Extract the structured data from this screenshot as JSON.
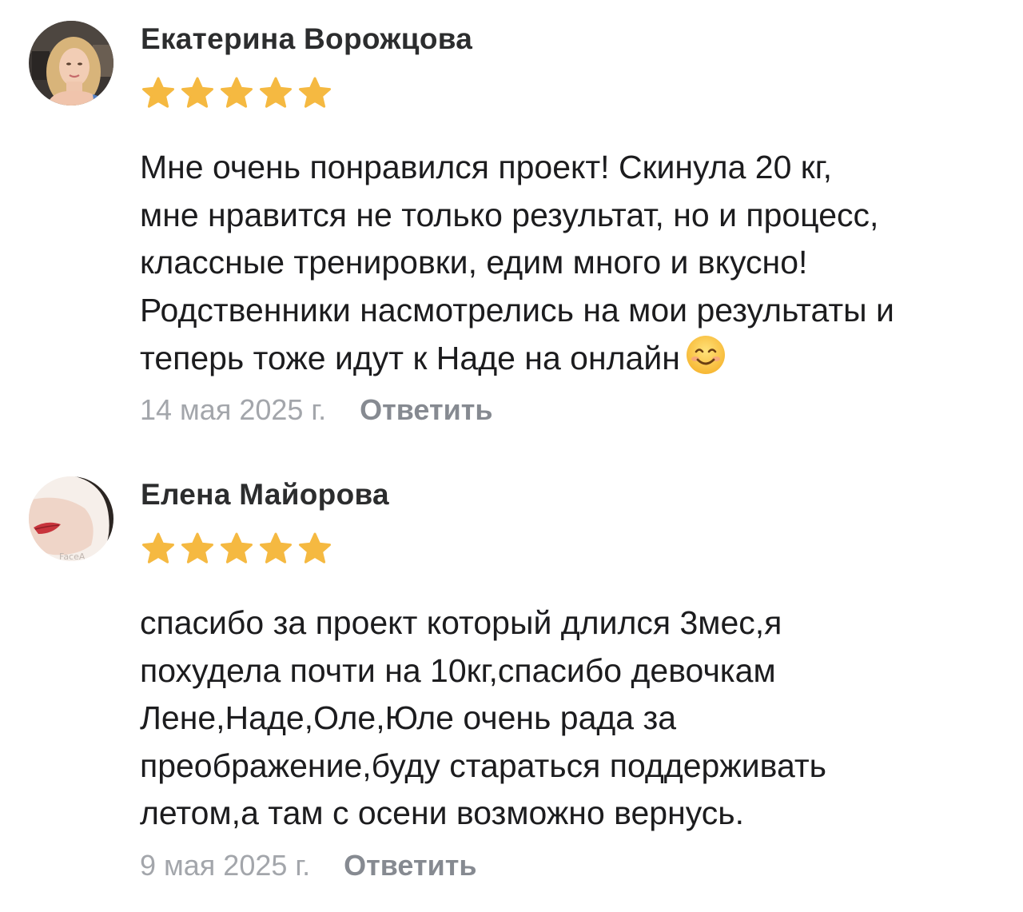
{
  "reviews": [
    {
      "author": "Екатерина Ворожцова",
      "rating": 5,
      "max_rating": 5,
      "text_lines": [
        "Мне очень понравился проект! Скинула 20 кг,",
        "мне нравится не только результат, но и процесс,",
        "классные тренировки, едим много и вкусно!",
        "Родственники насмотрелись на мои результаты и",
        "теперь тоже идут к Наде на онлайн"
      ],
      "date": "14 мая 2025 г.",
      "reply_label": "Ответить"
    },
    {
      "author": "Елена Майорова",
      "rating": 5,
      "max_rating": 5,
      "text_lines": [
        "спасибо за проект который длился 3мес,я",
        "похудела почти на 10кг,спасибо девочкам",
        "Лене,Наде,Оле,Юле очень рада за",
        "преображение,буду стараться поддерживать",
        "летом,а там с осени возможно вернусь."
      ],
      "date": "9 мая 2025 г.",
      "reply_label": "Ответить"
    }
  ],
  "colors": {
    "star": "#f5b941",
    "author": "#2c2d2e",
    "text": "#1c1c1e",
    "date": "#a3a6ab",
    "reply": "#868a91"
  }
}
